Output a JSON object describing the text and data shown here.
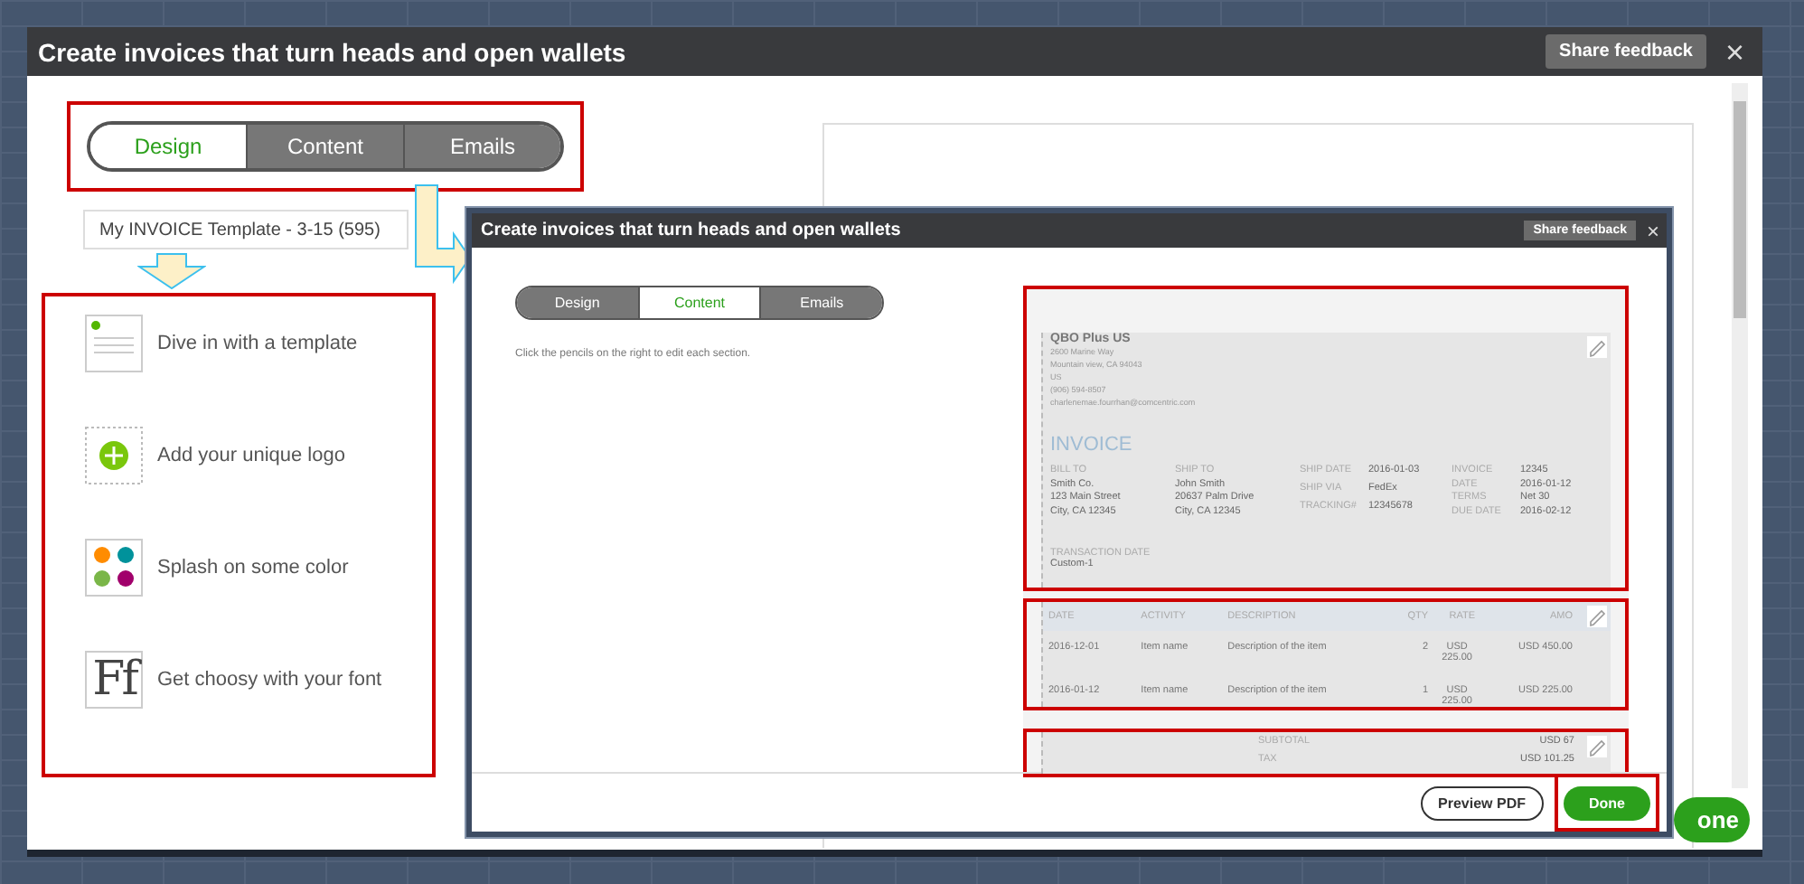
{
  "window": {
    "title": "Create invoices that turn heads and open wallets",
    "feedback_button": "Share feedback",
    "close": "×"
  },
  "tabs": [
    {
      "label": "Design",
      "selected": true
    },
    {
      "label": "Content",
      "selected": false
    },
    {
      "label": "Emails",
      "selected": false
    }
  ],
  "template_name": {
    "value": "My INVOICE Template - 3-15 (595)"
  },
  "features": [
    {
      "kind": "template",
      "label": "Dive in with a template"
    },
    {
      "kind": "logo",
      "label": "Add your unique logo"
    },
    {
      "kind": "color",
      "label": "Splash on some color"
    },
    {
      "kind": "font",
      "label": "Get choosy with your font",
      "icon_text": "Ff"
    }
  ],
  "done_button": "one",
  "inset_window": {
    "title": "Create invoices that turn heads and open wallets",
    "feedback_button": "Share feedback",
    "close": "×",
    "tabs": [
      {
        "label": "Design",
        "selected": false
      },
      {
        "label": "Content",
        "selected": true
      },
      {
        "label": "Emails",
        "selected": false
      }
    ],
    "hint": "Click the pencils on the right to edit each section.",
    "invoice": {
      "company": "QBO Plus US",
      "address_lines": [
        "2600 Marine Way",
        "Mountain view, CA 94043",
        "US",
        "(906) 594-8507",
        "charlenemae.fourrhan@comcentric.com"
      ],
      "heading": "INVOICE",
      "blocks": [
        {
          "label": "BILL TO",
          "lines": [
            "Smith Co.",
            "123 Main Street",
            "City, CA 12345"
          ]
        },
        {
          "label": "SHIP TO",
          "lines": [
            "John Smith",
            "20637 Palm Drive",
            "City, CA 12345"
          ]
        }
      ],
      "pairs": [
        [
          {
            "label": "SHIP DATE",
            "value": "2016-01-03"
          },
          {
            "label": "SHIP VIA",
            "value": "FedEx"
          },
          {
            "label": "TRACKING#",
            "value": "12345678"
          }
        ],
        [
          {
            "label": "INVOICE",
            "value": "12345"
          },
          {
            "label": "DATE",
            "value": "2016-01-12"
          },
          {
            "label": "TERMS",
            "value": "Net 30"
          },
          {
            "label": "DUE DATE",
            "value": "2016-02-12"
          }
        ]
      ],
      "transaction_label": "TRANSACTION DATE",
      "transaction_value": "Custom-1",
      "columns": [
        "DATE",
        "ACTIVITY",
        "DESCRIPTION",
        "QTY",
        "RATE",
        "AMO"
      ],
      "rows": [
        [
          "2016-12-01",
          "Item name",
          "Description of the item",
          "2",
          "USD 225.00",
          "USD 450.00"
        ],
        [
          "2016-01-12",
          "Item name",
          "Description of the item",
          "1",
          "USD 225.00",
          "USD 225.00"
        ]
      ],
      "totals": [
        {
          "label": "SUBTOTAL",
          "value": "USD 67"
        },
        {
          "label": "TAX",
          "value": "USD 101.25"
        }
      ]
    },
    "footer": {
      "preview": "Preview PDF",
      "done": "Done"
    }
  }
}
